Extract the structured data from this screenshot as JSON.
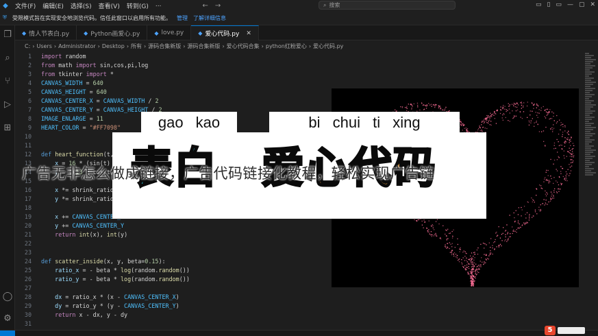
{
  "titlebar": {
    "menu": [
      "文件(F)",
      "编辑(E)",
      "选择(S)",
      "查看(V)",
      "转到(G)",
      "..."
    ],
    "nav": [
      "←",
      "→"
    ],
    "search_placeholder": "搜索",
    "window_controls": [
      "▭",
      "▯",
      "▭",
      "—",
      "▢",
      "✕"
    ]
  },
  "banner": {
    "message": "受限模式旨在实现安全地浏览代码。信任此窗口以启用所有功能。",
    "link_manage": "管理",
    "link_learn": "了解详细信息"
  },
  "tabs": [
    {
      "label": "情人节表白.py",
      "active": false
    },
    {
      "label": "Python画爱心.py",
      "active": false
    },
    {
      "label": "love.py",
      "active": false
    },
    {
      "label": "爱心代码.py",
      "active": true
    }
  ],
  "breadcrumb": [
    "C:",
    "Users",
    "Administrator",
    "Desktop",
    "所有",
    "源码合集新版",
    "源码合集新版",
    "爱心代码合集",
    "python红粉爱心",
    "爱心代码.py"
  ],
  "code_lines": [
    {
      "n": "1",
      "html": "<span class='k'>import</span> random"
    },
    {
      "n": "2",
      "html": "<span class='k'>from</span> math <span class='k'>import</span> sin,cos,pi,log"
    },
    {
      "n": "3",
      "html": "<span class='k'>from</span> tkinter <span class='k'>import</span> *"
    },
    {
      "n": "4",
      "html": "<span class='c'>CANVAS_WIDTH</span> = <span class='n'>640</span>"
    },
    {
      "n": "5",
      "html": "<span class='c'>CANVAS_HEIGHT</span> = <span class='n'>640</span>"
    },
    {
      "n": "6",
      "html": "<span class='c'>CANVAS_CENTER_X</span> = <span class='c'>CANVAS_WIDTH</span> / <span class='n'>2</span>"
    },
    {
      "n": "7",
      "html": "<span class='c'>CANVAS_CENTER_Y</span> = <span class='c'>CANVAS_HEIGHT</span> / <span class='n'>2</span>"
    },
    {
      "n": "8",
      "html": "<span class='c'>IMAGE_ENLARGE</span> = <span class='n'>11</span>"
    },
    {
      "n": "9",
      "html": "<span class='c'>HEART_COLOR</span> = <span class='s'>\"#FF7098\"</span>"
    },
    {
      "n": "10",
      "html": ""
    },
    {
      "n": "11",
      "html": ""
    },
    {
      "n": "12",
      "html": "<span class='kb'>def</span> <span class='f'>heart_function</span>(t, shrink_ratio: float = IMAGE_ENLARGE):"
    },
    {
      "n": "13",
      "html": "    <span class='v'>x</span> = <span class='n'>16</span> * (sin(t) ** <span class='n'>3</span>)"
    },
    {
      "n": "14",
      "html": "    <span class='v'>y</span> = -(<span class='n'>13</span> * cos(t) - <span class='n'>5</span> * cos(<span class='n'>2</span> * t))"
    },
    {
      "n": "15",
      "html": ""
    },
    {
      "n": "16",
      "html": "    <span class='v'>x</span> *= shrink_ratio"
    },
    {
      "n": "17",
      "html": "    <span class='v'>y</span> *= shrink_ratio"
    },
    {
      "n": "18",
      "html": ""
    },
    {
      "n": "19",
      "html": "    <span class='v'>x</span> += <span class='c'>CANVAS_CENTER_X</span>"
    },
    {
      "n": "20",
      "html": "    <span class='v'>y</span> += <span class='c'>CANVAS_CENTER_Y</span>"
    },
    {
      "n": "21",
      "html": "    <span class='k'>return</span> <span class='f'>int</span>(x), <span class='f'>int</span>(y)"
    },
    {
      "n": "22",
      "html": ""
    },
    {
      "n": "23",
      "html": ""
    },
    {
      "n": "24",
      "html": "<span class='kb'>def</span> <span class='f'>scatter_inside</span>(x, y, beta=<span class='n'>0.15</span>):"
    },
    {
      "n": "25",
      "html": "    <span class='v'>ratio_x</span> = - beta * <span class='f'>log</span>(random.<span class='f'>random</span>())"
    },
    {
      "n": "26",
      "html": "    <span class='v'>ratio_y</span> = - beta * <span class='f'>log</span>(random.<span class='f'>random</span>())"
    },
    {
      "n": "27",
      "html": ""
    },
    {
      "n": "28",
      "html": "    <span class='v'>dx</span> = ratio_x * (x - <span class='c'>CANVAS_CENTER_X</span>)"
    },
    {
      "n": "29",
      "html": "    <span class='v'>dy</span> = ratio_y * (y - <span class='c'>CANVAS_CENTER_Y</span>)"
    },
    {
      "n": "30",
      "html": "    <span class='k'>return</span> x - dx, y - dy"
    },
    {
      "n": "31",
      "html": ""
    }
  ],
  "overlay": {
    "pinyin_left": "gao kao",
    "pinyin_right": "bi chui ti xing",
    "big_left": "表白",
    "big_right": "爱心代码",
    "headline": "广告无非怎么做成链接，广告代码链接化教程，轻松实现广告链",
    "heart_color": "#ff7098"
  },
  "watermark_badge": "5"
}
